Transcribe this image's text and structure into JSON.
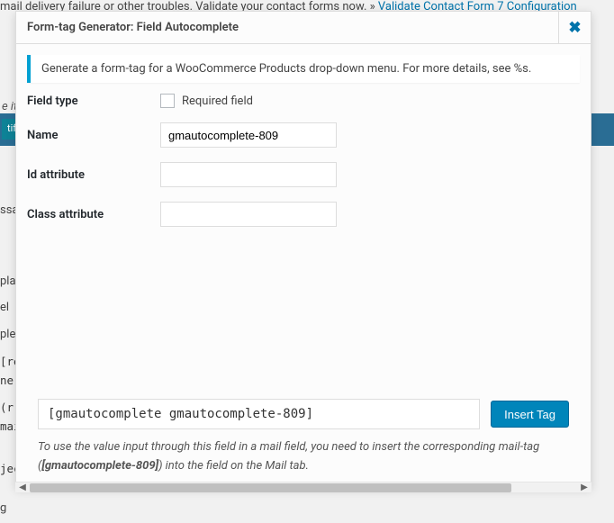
{
  "bg": {
    "warning_prefix": "mail delivery failure or other troubles. Validate your contact forms now. » ",
    "warning_link": "Validate Contact Form 7 Configuration",
    "hint_prefix": "e it",
    "abbrev1": "pla",
    "abbrev2": "el",
    "abbrev3": "plet",
    "abbrev4": "ssa",
    "abbrev5": "g",
    "teal_btn": "tif",
    "code1a": "[re",
    "code1b": "ne]",
    "code2a": "(r",
    "code2b": "mail",
    "code3": "ject"
  },
  "modal": {
    "title": "Form-tag Generator: Field Autocomplete",
    "close_glyph": "✖",
    "info": "Generate a form-tag for a WooCommerce Products drop-down menu. For more details, see %s.",
    "labels": {
      "field_type": "Field type",
      "required": "Required field",
      "name": "Name",
      "id_attr": "Id attribute",
      "class_attr": "Class attribute"
    },
    "values": {
      "name": "gmautocomplete-809",
      "id_attr": "",
      "class_attr": ""
    },
    "output": "[gmautocomplete gmautocomplete-809]",
    "insert_btn": "Insert Tag",
    "footer_hint_before": "To use the value input through this field in a mail field, you need to insert the corresponding mail-tag (",
    "footer_hint_tag": "[gmautocomplete-809]",
    "footer_hint_after": ") into the field on the Mail tab."
  }
}
